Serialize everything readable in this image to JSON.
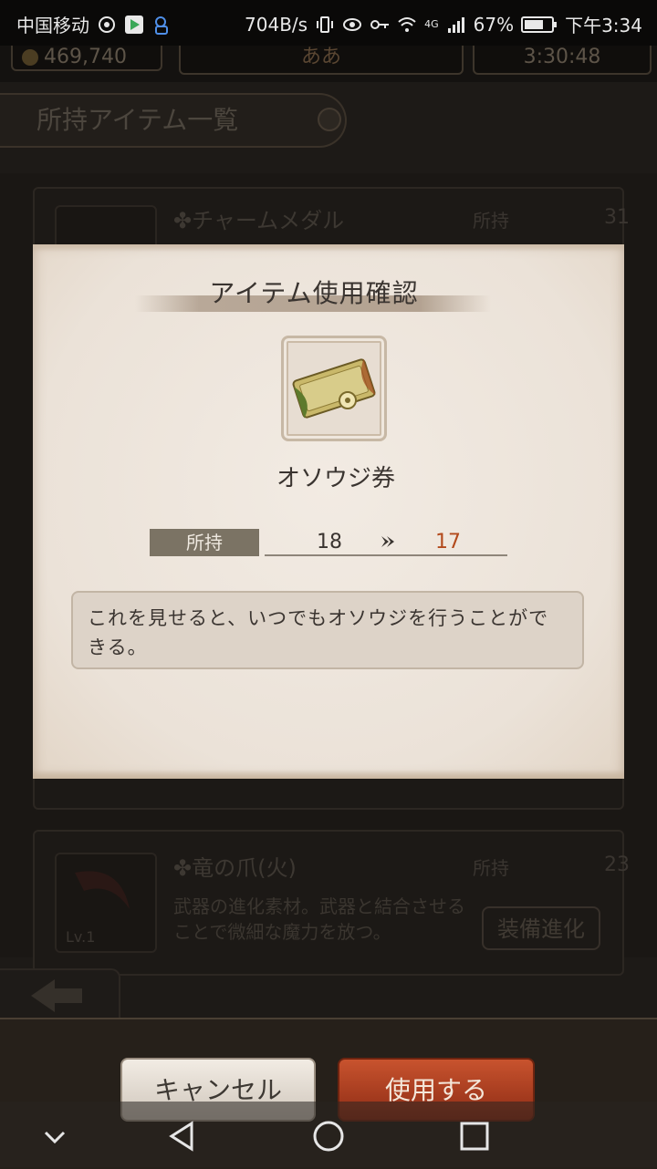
{
  "statusbar": {
    "carrier": "中国移动",
    "net_speed": "704B/s",
    "network": "4G",
    "battery": "67%",
    "time": "下午3:34"
  },
  "header": {
    "coins": "469,740",
    "name": "ああ",
    "timer": "3:30:48"
  },
  "page": {
    "title": "所持アイテム一覧"
  },
  "background_list": [
    {
      "name": "チャームメダル",
      "own_label": "所持",
      "count": "31"
    },
    {
      "name": "竜の爪(火)",
      "own_label": "所持",
      "count": "23",
      "level": "Lv.1",
      "description": "武器の進化素材。武器と結合させることで微細な魔力を放つ。",
      "button": "装備進化"
    }
  ],
  "modal": {
    "title": "アイテム使用確認",
    "item_name": "オソウジ券",
    "own_label": "所持",
    "before": "18",
    "after": "17",
    "description": "これを見せると、いつでもオソウジを行うことができる。"
  },
  "buttons": {
    "cancel": "キャンセル",
    "use": "使用する"
  },
  "colors": {
    "modal_bg": "#ede4db",
    "after_value": "#b34a1c",
    "use_button": "#b8462a"
  }
}
